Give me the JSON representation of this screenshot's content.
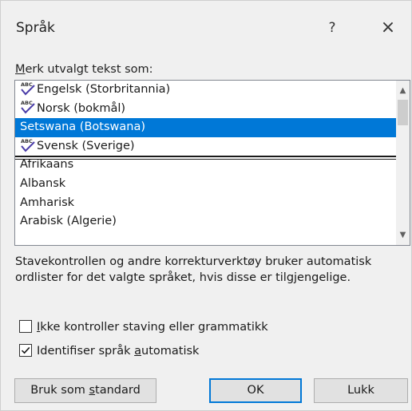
{
  "dialog": {
    "title": "Språk",
    "help_label": "?",
    "close_label": "×"
  },
  "section_label": "Merk utvalgt tekst som:",
  "languages": [
    {
      "label": "Engelsk (Storbritannia)",
      "spell_icon": true,
      "selected": false
    },
    {
      "label": "Norsk (bokmål)",
      "spell_icon": true,
      "selected": false
    },
    {
      "label": "Setswana (Botswana)",
      "spell_icon": false,
      "selected": true
    },
    {
      "label": "Svensk (Sverige)",
      "spell_icon": true,
      "selected": false
    },
    {
      "label": "Afrikaans",
      "spell_icon": false,
      "selected": false
    },
    {
      "label": "Albansk",
      "spell_icon": false,
      "selected": false
    },
    {
      "label": "Amharisk",
      "spell_icon": false,
      "selected": false
    },
    {
      "label": "Arabisk (Algerie)",
      "spell_icon": false,
      "selected": false
    }
  ],
  "description": "Stavekontrollen og andre korrekturverktøy bruker automatisk ordlister for det valgte språket, hvis disse er tilgjengelige.",
  "options": {
    "no_proofing": {
      "label": "Ikke kontroller staving eller grammatikk",
      "checked": false
    },
    "detect_language": {
      "label": "Identifiser språk automatisk",
      "checked": true
    }
  },
  "buttons": {
    "set_default": "Bruk som standard",
    "ok": "OK",
    "close": "Lukk"
  },
  "colors": {
    "selection": "#0078d7",
    "default_button_border": "#0078d7"
  }
}
